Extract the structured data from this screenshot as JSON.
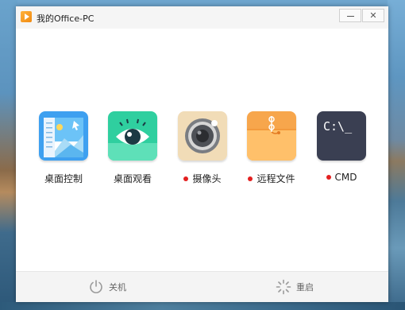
{
  "window": {
    "title": "我的Office-PC",
    "close_glyph": "✕"
  },
  "tiles": [
    {
      "label": "桌面控制",
      "icon": "desktop-control-icon",
      "color": "#3ea0f0",
      "dot": false
    },
    {
      "label": "桌面观看",
      "icon": "eye-icon",
      "color": "#2fcf9f",
      "dot": false
    },
    {
      "label": "摄像头",
      "icon": "camera-icon",
      "color": "#f1dcb7",
      "dot": true
    },
    {
      "label": "远程文件",
      "icon": "folder-icon",
      "color": "#f7a64c",
      "dot": true
    },
    {
      "label": "CMD",
      "icon": "terminal-icon",
      "color": "#3a3f52",
      "dot": true,
      "icon_text": "C:\\_"
    }
  ],
  "footer": {
    "shutdown_label": "关机",
    "restart_label": "重启"
  },
  "colors": {
    "status_dot": "#e32020",
    "titlebar_bg": "#f5f5f5",
    "footer_bg": "#f4f4f4"
  }
}
